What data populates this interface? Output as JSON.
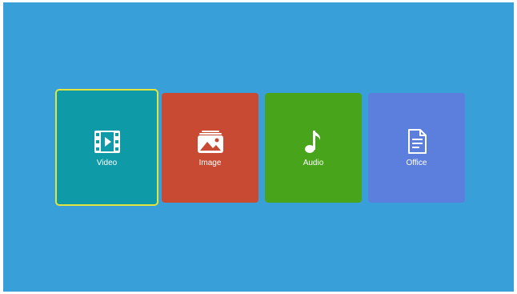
{
  "menu": {
    "selected_index": 0,
    "tiles": [
      {
        "label": "Video",
        "icon": "film-play-icon",
        "color": "#0f9aa8"
      },
      {
        "label": "Image",
        "icon": "image-stack-icon",
        "color": "#c84a32"
      },
      {
        "label": "Audio",
        "icon": "music-note-icon",
        "color": "#48a51b"
      },
      {
        "label": "Office",
        "icon": "document-icon",
        "color": "#5c7fde"
      }
    ]
  },
  "colors": {
    "background": "#389fd9",
    "selection_border": "#e3e53c"
  }
}
